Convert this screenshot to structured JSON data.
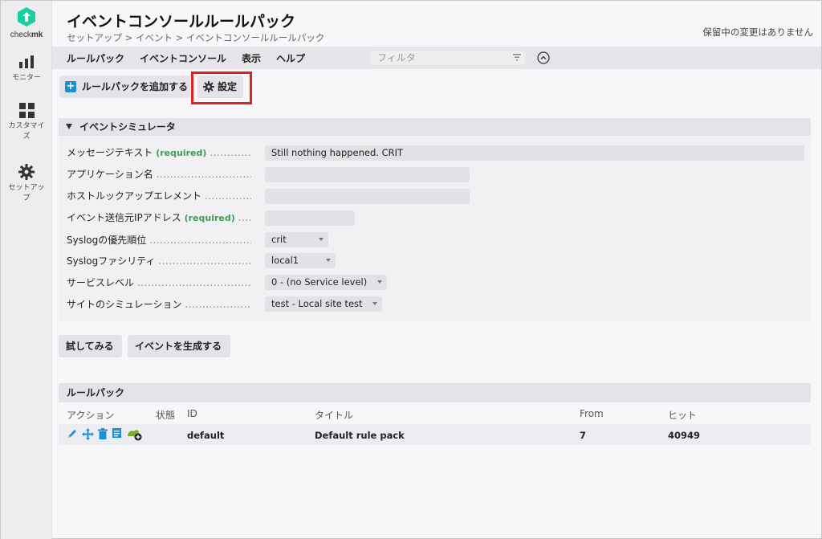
{
  "sidebar": {
    "logo_brand_a": "check",
    "logo_brand_b": "mk",
    "items": [
      {
        "label": "モニター",
        "icon": "bar-chart-icon"
      },
      {
        "label": "カスタマイズ",
        "icon": "grid-icon"
      },
      {
        "label": "セットアップ",
        "icon": "gear-icon"
      }
    ]
  },
  "header": {
    "title": "イベントコンソールルールパック",
    "breadcrumb": "セットアップ > イベント > イベントコンソールルールパック",
    "pending": "保留中の変更はありません"
  },
  "menubar": {
    "items": [
      "ルールパック",
      "イベントコンソール",
      "表示",
      "ヘルプ"
    ],
    "filter_placeholder": "フィルタ"
  },
  "toolbar": {
    "add_label": "ルールパックを追加する",
    "settings_label": "設定"
  },
  "simulator": {
    "title": "イベントシミュレータ",
    "rows": [
      {
        "label": "メッセージテキスト",
        "required": "(required)",
        "value": "Still nothing happened. CRIT"
      },
      {
        "label": "アプリケーション名",
        "required": "",
        "value": ""
      },
      {
        "label": "ホストルックアップエレメント",
        "required": "",
        "value": ""
      },
      {
        "label": "イベント送信元IPアドレス",
        "required": "(required)",
        "value": ""
      },
      {
        "label": "Syslogの優先順位",
        "required": "",
        "value": "crit"
      },
      {
        "label": "Syslogファシリティ",
        "required": "",
        "value": "local1"
      },
      {
        "label": "サービスレベル",
        "required": "",
        "value": "0 - (no Service level)"
      },
      {
        "label": "サイトのシミュレーション",
        "required": "",
        "value": "test - Local site test"
      }
    ],
    "try_label": "試してみる",
    "generate_label": "イベントを生成する"
  },
  "rulepacks": {
    "title": "ルールパック",
    "columns": [
      "アクション",
      "状態",
      "ID",
      "タイトル",
      "From",
      "ヒット"
    ],
    "rows": [
      {
        "id": "default",
        "title": "Default rule pack",
        "from": "7",
        "hits": "40949"
      }
    ]
  },
  "colors": {
    "accent": "#1b8fd6",
    "required": "#3d9b5a",
    "highlight": "#e0201a",
    "logo": "#15d1a0"
  }
}
